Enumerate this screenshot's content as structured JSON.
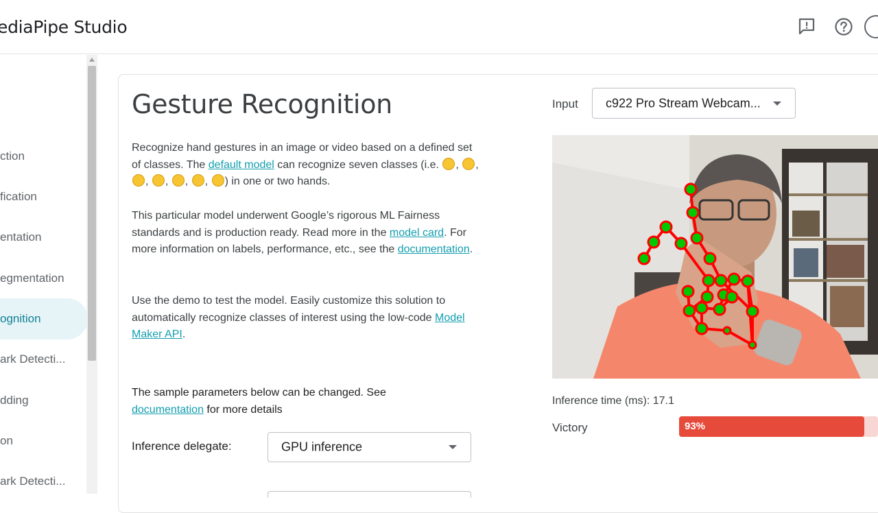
{
  "header": {
    "app_title": "ediaPipe Studio",
    "feedback_icon": "feedback-icon",
    "help_icon": "help-icon"
  },
  "sidebar": {
    "items": [
      {
        "label": "ction",
        "active": false
      },
      {
        "label": "fication",
        "active": false
      },
      {
        "label": "entation",
        "active": false
      },
      {
        "label": "egmentation",
        "active": false
      },
      {
        "label": "ognition",
        "active": true
      },
      {
        "label": "ark Detecti...",
        "active": false
      },
      {
        "label": "dding",
        "active": false
      },
      {
        "label": "on",
        "active": false
      },
      {
        "label": "ark Detecti...",
        "active": false
      }
    ]
  },
  "main": {
    "title": "Gesture Recognition",
    "intro": {
      "t1": "Recognize hand gestures in an image or video based on a defined set of classes. The ",
      "link": "default model",
      "t2": " can recognize seven classes (i.e. ",
      "t3": ") in one or two hands.",
      "emoji_count": 7
    },
    "fairness": {
      "t1": "This particular model underwent Google’s rigorous ML Fairness standards and is production ready. Read more in the ",
      "link1": "model card",
      "t2": ". For more information on labels, performance, etc., see the ",
      "link2": "documentation",
      "t3": "."
    },
    "demo": {
      "t1": "Use the demo to test the model. Easily customize this solution to automatically recognize classes of interest using the low-code ",
      "link": "Model Maker API",
      "t2": "."
    },
    "params": {
      "t1": "The sample parameters below can be changed. See ",
      "link": "documentation",
      "t2": " for more details"
    },
    "delegate": {
      "label": "Inference delegate:",
      "value": "GPU inference"
    }
  },
  "input": {
    "label": "Input",
    "value": "c922 Pro Stream Webcam..."
  },
  "results": {
    "inference_label": "Inference time (ms): 17.1",
    "gesture": "Victory",
    "score_label": "93%",
    "score": 0.93,
    "bar_color": "#e64a3b"
  },
  "colors": {
    "accent": "#129eaf",
    "active_nav_bg": "#e6f4f7",
    "landmark": "#00c800",
    "connection": "#ff0000"
  }
}
